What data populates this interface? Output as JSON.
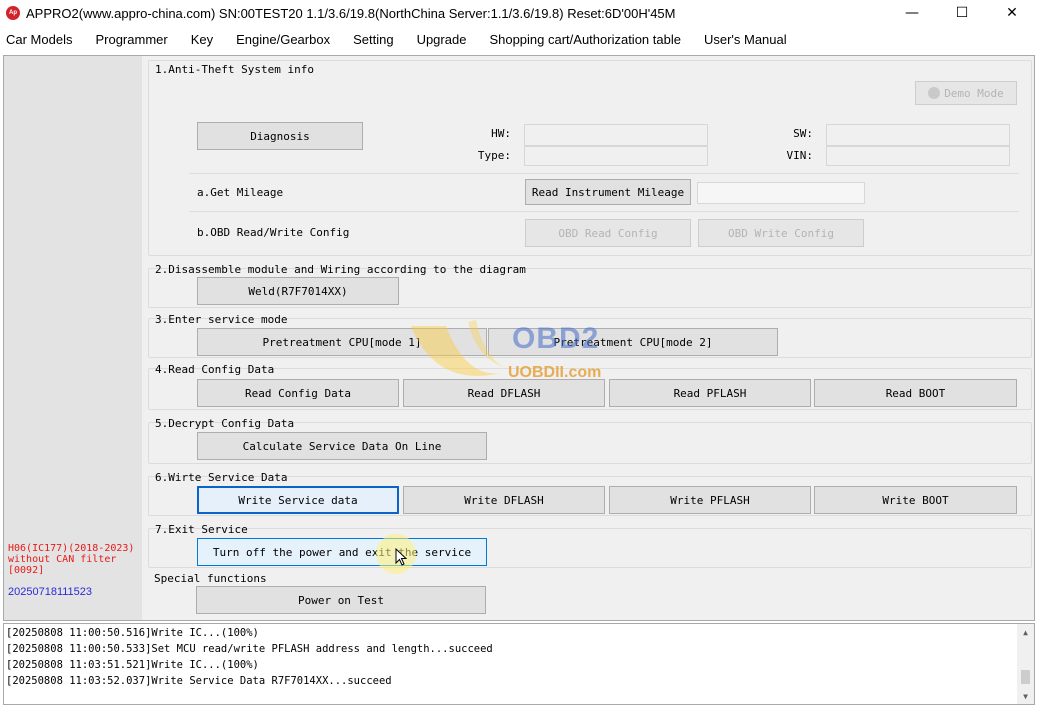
{
  "window": {
    "title": "APPRO2(www.appro-china.com)  SN:00TEST20  1.1/3.6/19.8(NorthChina Server:1.1/3.6/19.8)  Reset:6D'00H'45M",
    "icon_label": "Ap",
    "minimize_glyph": "—",
    "maximize_glyph": "☐",
    "close_glyph": "✕"
  },
  "menu": [
    "Car Models",
    "Programmer",
    "Key",
    "Engine/Gearbox",
    "Setting",
    "Upgrade",
    "Shopping cart/Authorization table",
    "User's Manual"
  ],
  "sidebar": {
    "model": "H06(IC177)(2018-2023) without CAN filter [0092]",
    "date": "20250718111523"
  },
  "sections": {
    "s1": {
      "title": "1.Anti-Theft System info",
      "demo_mode": "Demo Mode",
      "diagnosis": "Diagnosis",
      "hw_label": "HW:",
      "type_label": "Type:",
      "sw_label": "SW:",
      "vin_label": "VIN:",
      "hw_value": "",
      "type_value": "",
      "sw_value": "",
      "vin_value": "",
      "get_mileage_label": "a.Get Mileage",
      "read_instrument_mileage": "Read Instrument Mileage",
      "mileage_value": "",
      "obd_config_label": "b.OBD Read/Write Config",
      "obd_read_config": "OBD Read Config",
      "obd_write_config": "OBD Write Config"
    },
    "s2": {
      "title": "2.Disassemble module and Wiring according to the diagram",
      "weld": "Weld(R7F7014XX)"
    },
    "s3": {
      "title": "3.Enter service mode",
      "mode1": "Pretreatment CPU[mode 1]",
      "mode2": "Pretreatment CPU[mode 2]"
    },
    "s4": {
      "title": "4.Read Config Data",
      "read_config": "Read Config Data",
      "read_dflash": "Read DFLASH",
      "read_pflash": "Read PFLASH",
      "read_boot": "Read BOOT"
    },
    "s5": {
      "title": "5.Decrypt Config Data",
      "calc": "Calculate Service Data On Line"
    },
    "s6": {
      "title": "6.Wirte Service Data",
      "write_service": "Write Service data",
      "write_dflash": "Write DFLASH",
      "write_pflash": "Write PFLASH",
      "write_boot": "Write BOOT"
    },
    "s7": {
      "title": "7.Exit Service",
      "exit": "Turn off the power and exit the service"
    },
    "special": {
      "title": "Special functions",
      "power_test": "Power on Test"
    }
  },
  "log": [
    "[20250808 11:00:50.516]Write IC...(100%)",
    "[20250808 11:00:50.533]Set MCU read/write PFLASH address and length...succeed",
    "[20250808 11:03:51.521]Write IC...(100%)",
    "[20250808 11:03:52.037]Write Service Data R7F7014XX...succeed"
  ],
  "watermark": {
    "brand": "OBD2",
    "site": "UOBDII.com"
  }
}
